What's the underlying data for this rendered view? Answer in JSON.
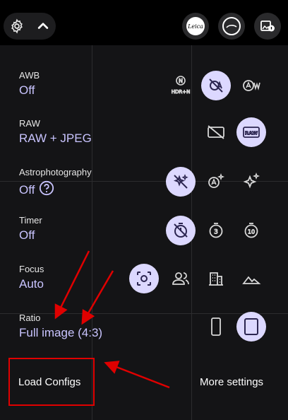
{
  "settings": [
    {
      "label": "AWB",
      "value": "Off"
    },
    {
      "label": "RAW",
      "value": "RAW + JPEG"
    },
    {
      "label": "Astrophotography",
      "value": "Off"
    },
    {
      "label": "Timer",
      "value": "Off"
    },
    {
      "label": "Focus",
      "value": "Auto"
    },
    {
      "label": "Ratio",
      "value": "Full image (4:3)"
    }
  ],
  "awb_options": {
    "hdr_label": "HDR+N"
  },
  "footer": {
    "load_configs": "Load Configs",
    "more_settings": "More settings"
  },
  "colors": {
    "accent": "#c9c4ff",
    "selected_bg": "#dcd8ff",
    "annotation": "#e00000"
  }
}
